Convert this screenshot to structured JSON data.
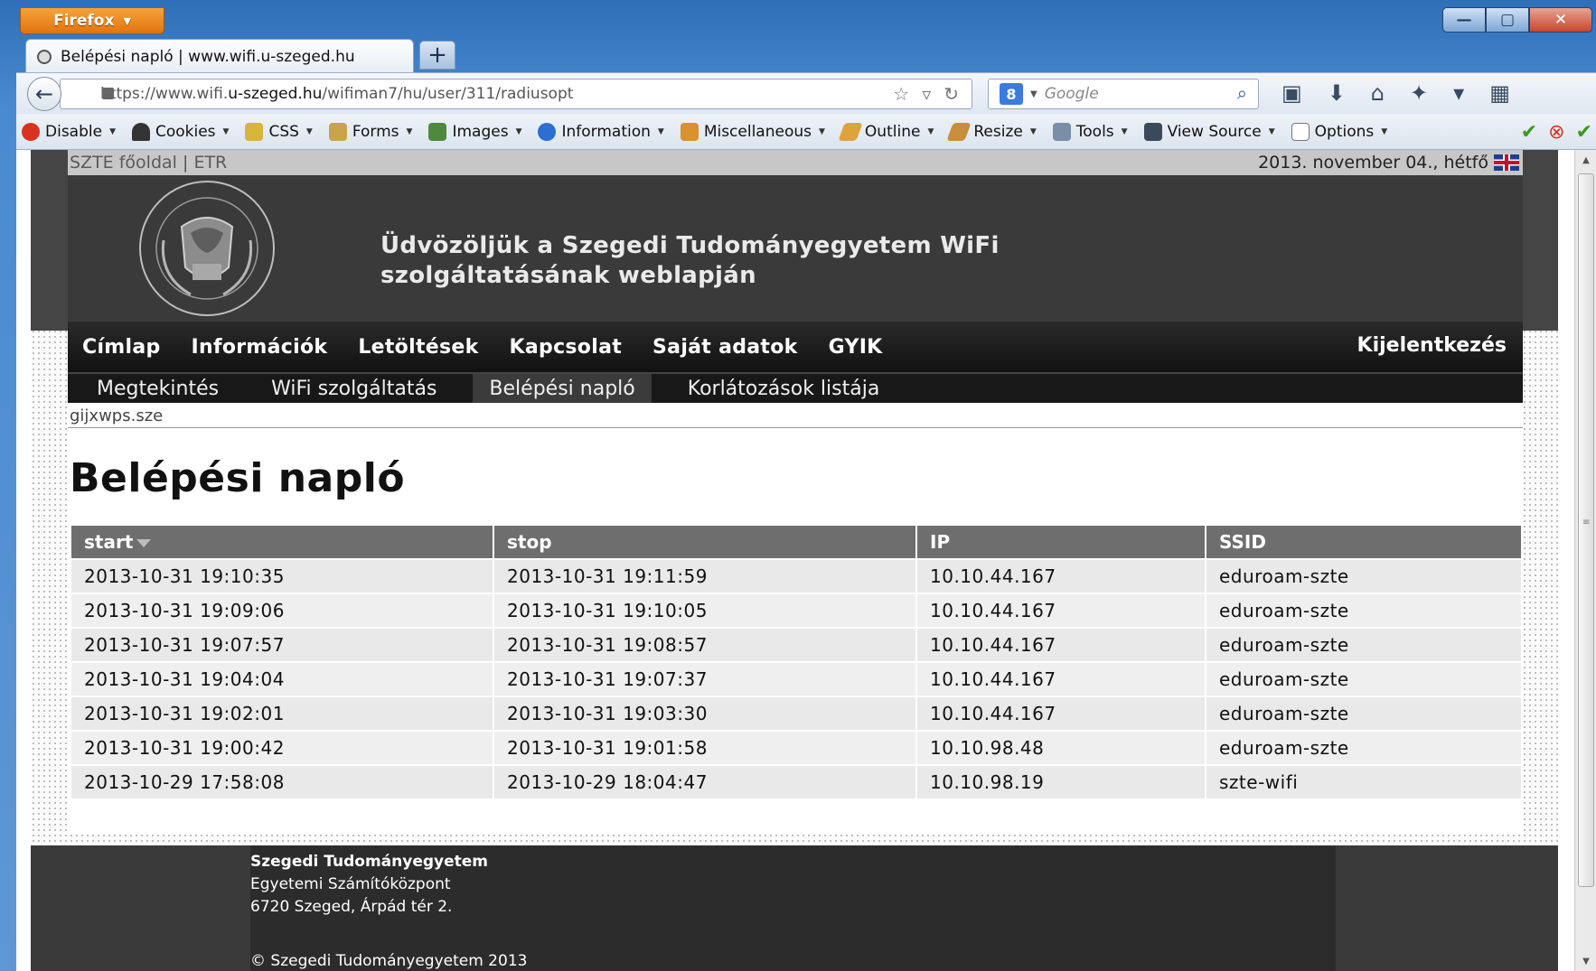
{
  "browser": {
    "menu_label": "Firefox",
    "window_controls": {
      "minimize": "—",
      "maximize": "▢",
      "close": "✕"
    },
    "tab_title": "Belépési napló | www.wifi.u-szeged.hu",
    "new_tab": "+",
    "url_prefix": "https://www.wifi.",
    "url_domain": "u-szeged.hu",
    "url_path": "/wifiman7/hu/user/311/radiusopt",
    "search_placeholder": "Google",
    "search_engine_letter": "8",
    "devbar": [
      {
        "label": "Disable",
        "icon": "disable-icon",
        "color": "#d9331f"
      },
      {
        "label": "Cookies",
        "icon": "cookies-icon",
        "color": "#333333"
      },
      {
        "label": "CSS",
        "icon": "css-icon",
        "color": "#d7b43a"
      },
      {
        "label": "Forms",
        "icon": "forms-icon",
        "color": "#c9a44c"
      },
      {
        "label": "Images",
        "icon": "images-icon",
        "color": "#4d8a3c"
      },
      {
        "label": "Information",
        "icon": "information-icon",
        "color": "#2a6fd1"
      },
      {
        "label": "Miscellaneous",
        "icon": "miscellaneous-icon",
        "color": "#d8922e"
      },
      {
        "label": "Outline",
        "icon": "outline-icon",
        "color": "#e0a23d"
      },
      {
        "label": "Resize",
        "icon": "resize-icon",
        "color": "#c98e3a"
      },
      {
        "label": "Tools",
        "icon": "tools-icon",
        "color": "#7a8ea8"
      },
      {
        "label": "View Source",
        "icon": "view-source-icon",
        "color": "#3a4a5a"
      },
      {
        "label": "Options",
        "icon": "options-icon",
        "color": "#777777"
      }
    ]
  },
  "site": {
    "top_links": {
      "home": "SZTE főoldal",
      "separator": "|",
      "etr": "ETR"
    },
    "date": "2013. november 04., hétfő",
    "welcome": "Üdvözöljük a Szegedi Tudományegyetem WiFi szolgáltatásának weblapján",
    "main_nav": [
      "Címlap",
      "Információk",
      "Letöltések",
      "Kapcsolat",
      "Saját adatok",
      "GYIK"
    ],
    "logout": "Kijelentkezés",
    "sub_nav": [
      {
        "label": "Megtekintés",
        "active": false
      },
      {
        "label": "WiFi szolgáltatás",
        "active": false
      },
      {
        "label": "Belépési napló",
        "active": true
      },
      {
        "label": "Korlátozások listája",
        "active": false
      }
    ],
    "username": "gijxwps.sze",
    "page_title": "Belépési napló",
    "table": {
      "headers": [
        "start",
        "stop",
        "IP",
        "SSID"
      ],
      "rows": [
        [
          "2013-10-31 19:10:35",
          "2013-10-31 19:11:59",
          "10.10.44.167",
          "eduroam-szte"
        ],
        [
          "2013-10-31 19:09:06",
          "2013-10-31 19:10:05",
          "10.10.44.167",
          "eduroam-szte"
        ],
        [
          "2013-10-31 19:07:57",
          "2013-10-31 19:08:57",
          "10.10.44.167",
          "eduroam-szte"
        ],
        [
          "2013-10-31 19:04:04",
          "2013-10-31 19:07:37",
          "10.10.44.167",
          "eduroam-szte"
        ],
        [
          "2013-10-31 19:02:01",
          "2013-10-31 19:03:30",
          "10.10.44.167",
          "eduroam-szte"
        ],
        [
          "2013-10-31 19:00:42",
          "2013-10-31 19:01:58",
          "10.10.98.48",
          "eduroam-szte"
        ],
        [
          "2013-10-29 17:58:08",
          "2013-10-29 18:04:47",
          "10.10.98.19",
          "szte-wifi"
        ]
      ]
    },
    "footer": {
      "org": "Szegedi Tudományegyetem",
      "dept": "Egyetemi Számítóközpont",
      "address": "6720 Szeged, Árpád tér 2.",
      "copyright": "© Szegedi Tudományegyetem 2013"
    }
  }
}
